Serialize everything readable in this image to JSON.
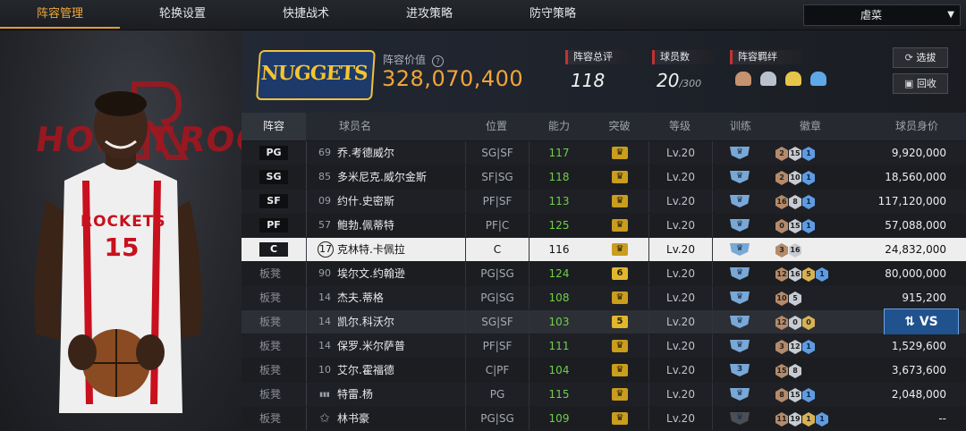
{
  "tabs": [
    {
      "label": "阵容管理",
      "active": true
    },
    {
      "label": "轮换设置",
      "active": false
    },
    {
      "label": "快捷战术",
      "active": false
    },
    {
      "label": "进攻策略",
      "active": false
    },
    {
      "label": "防守策略",
      "active": false
    }
  ],
  "difficulty": {
    "value": "虐菜"
  },
  "header": {
    "team_logo_text": "NUGGETS",
    "lineup_value_label": "阵容价值",
    "lineup_value": "328,070,400",
    "stats": [
      {
        "label": "阵容总评",
        "value": "118"
      },
      {
        "label": "球员数",
        "value": "20",
        "suffix": "/300"
      },
      {
        "label": "阵容羁绊"
      }
    ],
    "buttons": {
      "scout": "选拔",
      "recycle": "回收"
    }
  },
  "player_panel": {
    "jersey_team": "ROCKETS",
    "jersey_number": "15",
    "bg_text_left": "HOUST",
    "bg_text_right": "ROCK"
  },
  "table": {
    "columns": [
      "阵容",
      "球员名",
      "位置",
      "能力",
      "突破",
      "等级",
      "训练",
      "徽章",
      "球员身价"
    ],
    "rows": [
      {
        "slot": "PG",
        "num": "69",
        "name": "乔.考德威尔",
        "position": "SG|SF",
        "overall": "117",
        "breakthrough": "",
        "level": "Lv.20",
        "badges": [
          {
            "t": "bronze",
            "v": "2"
          },
          {
            "t": "silver",
            "v": "15"
          },
          {
            "t": "hof",
            "v": "1"
          }
        ],
        "value": "9,920,000"
      },
      {
        "slot": "SG",
        "num": "85",
        "name": "多米尼克.威尔金斯",
        "position": "SF|SG",
        "overall": "118",
        "breakthrough": "",
        "level": "Lv.20",
        "badges": [
          {
            "t": "bronze",
            "v": "2"
          },
          {
            "t": "silver",
            "v": "10"
          },
          {
            "t": "hof",
            "v": "1"
          }
        ],
        "value": "18,560,000"
      },
      {
        "slot": "SF",
        "num": "09",
        "name": "约什.史密斯",
        "position": "PF|SF",
        "overall": "113",
        "breakthrough": "",
        "level": "Lv.20",
        "badges": [
          {
            "t": "bronze",
            "v": "16"
          },
          {
            "t": "silver",
            "v": "8"
          },
          {
            "t": "hof",
            "v": "1"
          }
        ],
        "value": "117,120,000"
      },
      {
        "slot": "PF",
        "num": "57",
        "name": "鲍勃.佩蒂特",
        "position": "PF|C",
        "overall": "125",
        "breakthrough": "",
        "level": "Lv.20",
        "badges": [
          {
            "t": "bronze",
            "v": "0"
          },
          {
            "t": "silver",
            "v": "15"
          },
          {
            "t": "hof",
            "v": "1"
          }
        ],
        "value": "57,088,000"
      },
      {
        "slot": "C",
        "num": "17",
        "name": "克林特.卡佩拉",
        "position": "C",
        "overall": "116",
        "breakthrough": "",
        "level": "Lv.20",
        "badges": [
          {
            "t": "bronze",
            "v": "3"
          },
          {
            "t": "silver",
            "v": "16"
          }
        ],
        "value": "24,832,000"
      },
      {
        "slot": "板凳",
        "num": "90",
        "name": "埃尔文.约翰逊",
        "position": "PG|SG",
        "overall": "124",
        "breakthrough": "6",
        "level": "Lv.20",
        "badges": [
          {
            "t": "bronze",
            "v": "12"
          },
          {
            "t": "silver",
            "v": "16"
          },
          {
            "t": "gold",
            "v": "5"
          },
          {
            "t": "hof",
            "v": "1"
          }
        ],
        "value": "80,000,000"
      },
      {
        "slot": "板凳",
        "num": "14",
        "name": "杰夫.蒂格",
        "position": "PG|SG",
        "overall": "108",
        "breakthrough": "",
        "level": "Lv.20",
        "badges": [
          {
            "t": "bronze",
            "v": "10"
          },
          {
            "t": "silver",
            "v": "5"
          }
        ],
        "value": "915,200"
      },
      {
        "slot": "板凳",
        "num": "14",
        "name": "凯尔.科沃尔",
        "position": "SG|SF",
        "overall": "103",
        "breakthrough": "5",
        "level": "Lv.20",
        "badges": [
          {
            "t": "bronze",
            "v": "12"
          },
          {
            "t": "silver",
            "v": "0"
          },
          {
            "t": "gold",
            "v": "0"
          }
        ],
        "value": "",
        "vs": "VS"
      },
      {
        "slot": "板凳",
        "num": "14",
        "name": "保罗.米尔萨普",
        "position": "PF|SF",
        "overall": "111",
        "breakthrough": "",
        "level": "Lv.20",
        "badges": [
          {
            "t": "bronze",
            "v": "3"
          },
          {
            "t": "silver",
            "v": "12"
          },
          {
            "t": "hof",
            "v": "1"
          }
        ],
        "value": "1,529,600"
      },
      {
        "slot": "板凳",
        "num": "10",
        "name": "艾尔.霍福德",
        "position": "C|PF",
        "overall": "104",
        "breakthrough": "",
        "level": "Lv.20",
        "train": "3",
        "badges": [
          {
            "t": "bronze",
            "v": "15"
          },
          {
            "t": "silver",
            "v": "8"
          }
        ],
        "value": "3,673,600"
      },
      {
        "slot": "板凳",
        "num": "",
        "name": "特雷.杨",
        "position": "PG",
        "overall": "115",
        "breakthrough": "",
        "level": "Lv.20",
        "badges": [
          {
            "t": "bronze",
            "v": "8"
          },
          {
            "t": "silver",
            "v": "15"
          },
          {
            "t": "hof",
            "v": "1"
          }
        ],
        "value": "2,048,000"
      },
      {
        "slot": "板凳",
        "num": "",
        "name": "林书豪",
        "position": "PG|SG",
        "overall": "109",
        "breakthrough": "",
        "level": "Lv.20",
        "badges": [
          {
            "t": "bronze",
            "v": "11"
          },
          {
            "t": "silver",
            "v": "19"
          },
          {
            "t": "gold",
            "v": "1"
          },
          {
            "t": "hof",
            "v": "1"
          }
        ],
        "value": "--"
      }
    ]
  },
  "colors": {
    "accent": "#e89a2e",
    "overall_green": "#6fd049",
    "selected_row": "#eeeeee",
    "vs_blue": "#20528d"
  }
}
